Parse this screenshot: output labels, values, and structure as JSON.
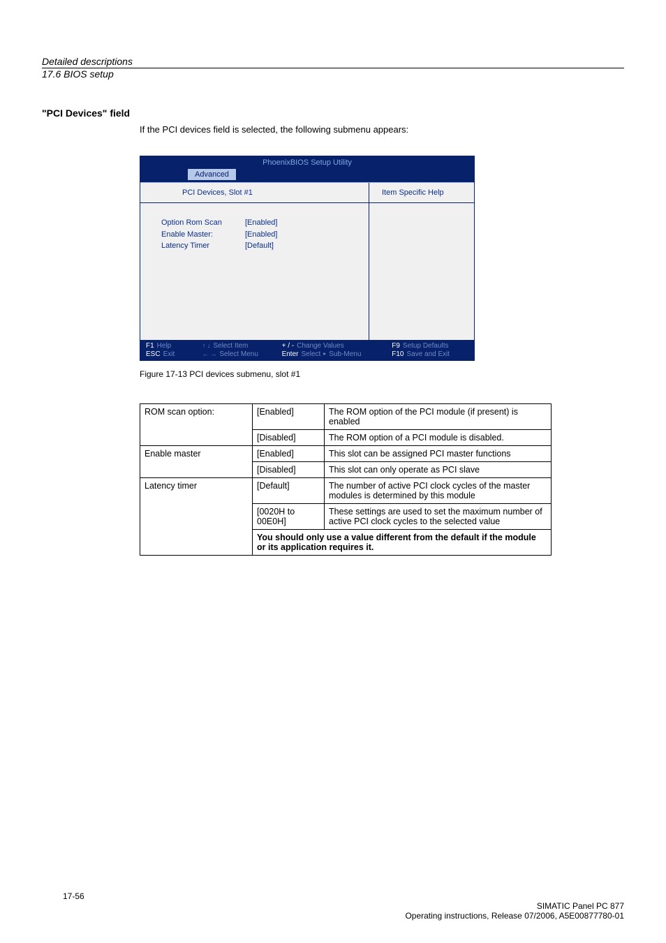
{
  "header": {
    "title": "Detailed descriptions",
    "subtitle": "17.6 BIOS setup"
  },
  "section": {
    "heading": "\"PCI Devices\" field",
    "intro": "If the PCI devices field is selected, the following submenu appears:"
  },
  "bios": {
    "title": "PhoenixBIOS Setup Utility",
    "menu_active": "Advanced",
    "left_header": "PCI Devices, Slot  #1",
    "right_header": "Item Specific Help",
    "settings": [
      {
        "label": "Option Rom Scan",
        "value": "[Enabled]"
      },
      {
        "label": "Enable Master:",
        "value": "[Enabled]"
      },
      {
        "label": "Latency Timer",
        "value": "[Default]"
      }
    ],
    "footer": {
      "c1": {
        "l1k": "F1",
        "l1d": "Help",
        "l2k": "ESC",
        "l2d": "Exit"
      },
      "c2": {
        "l1a": "↑ ↓",
        "l1d": "Select Item",
        "l2a": "← →",
        "l2d": "Select Menu"
      },
      "c3": {
        "l1k": "+ / -",
        "l1d": "Change Values",
        "l2k": "Enter",
        "l2d": "Select",
        "l2t": "▸",
        "l2s": "Sub-Menu"
      },
      "c4": {
        "l1k": "F9",
        "l1d": "Setup Defaults",
        "l2k": "F10",
        "l2d": "Save and Exit"
      }
    }
  },
  "figure_caption": "Figure 17-13   PCI devices submenu, slot #1",
  "table": {
    "rows": [
      {
        "name": "ROM scan option:",
        "val": "[Enabled]",
        "desc": "The ROM option of the PCI module (if present) is enabled",
        "rowspan": 2
      },
      {
        "name": "",
        "val": "[Disabled]",
        "desc": "The ROM option of a PCI module is disabled."
      },
      {
        "name": "Enable master",
        "val": "[Enabled]",
        "desc": "This slot can be assigned PCI master functions",
        "rowspan": 2
      },
      {
        "name": "",
        "val": "[Disabled]",
        "desc": "This slot can only operate as PCI slave"
      },
      {
        "name": "Latency timer",
        "val": "[Default]",
        "desc": "The number of active PCI clock cycles of the master modules is determined by this module",
        "rowspan": 3
      },
      {
        "name": "",
        "val": "[0020H to 00E0H]",
        "desc": "These settings are used to set the maximum number of active PCI clock cycles to the selected value"
      }
    ],
    "note": "You should only use a value different from the default if the module or its application requires it."
  },
  "footer": {
    "right1": "SIMATIC Panel PC 877",
    "right2": "Operating instructions, Release 07/2006, A5E00877780-01",
    "left": "17-56"
  }
}
